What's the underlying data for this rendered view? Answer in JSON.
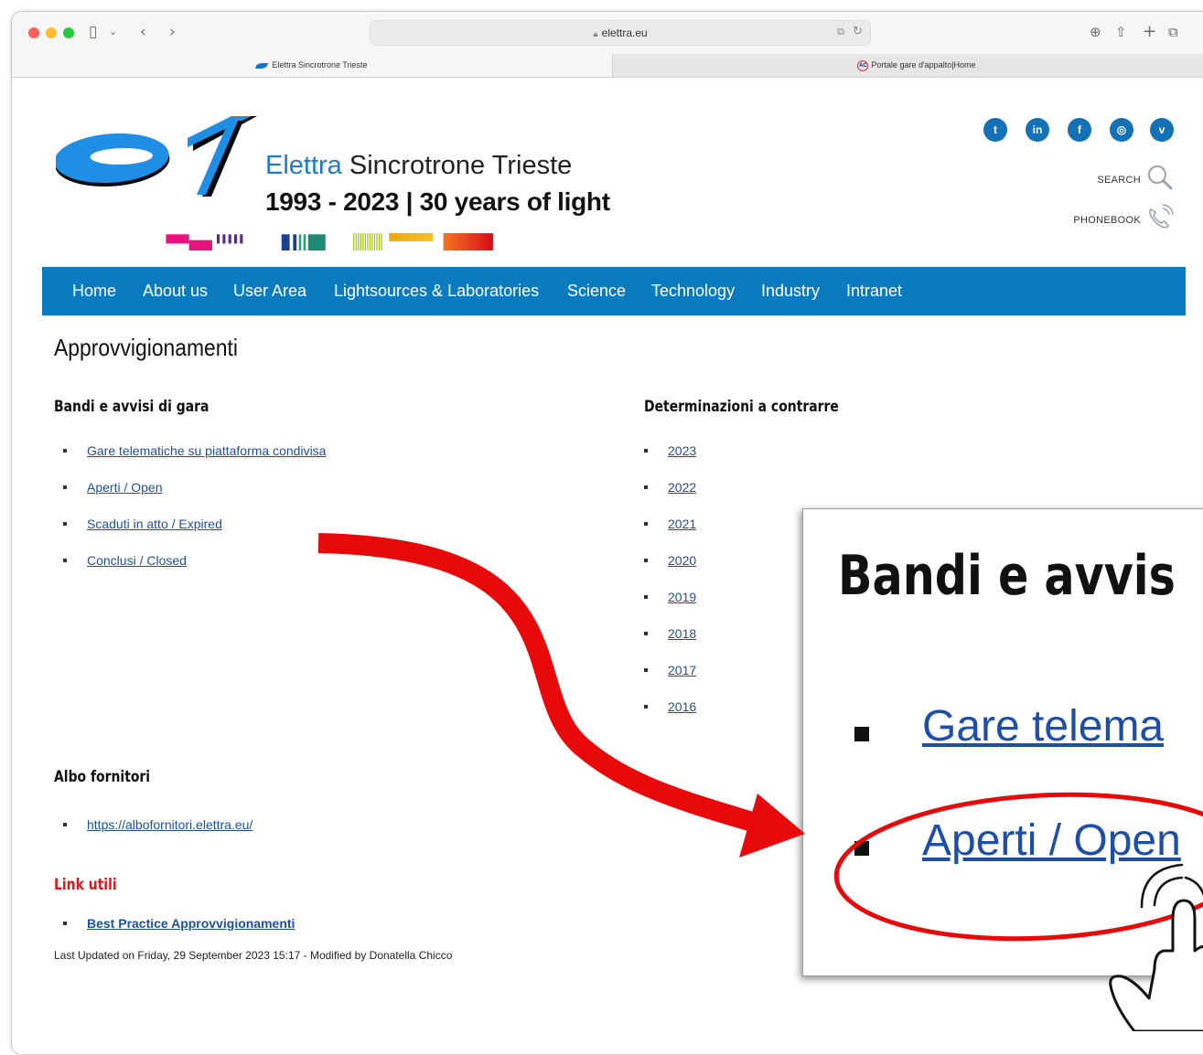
{
  "browser": {
    "url": "elettra.eu",
    "tabs": [
      {
        "label": "Elettra Sincrotrone Trieste"
      },
      {
        "label": "Portale gare d'appalto|Home"
      }
    ],
    "tab2_favicon_text": "AC"
  },
  "header": {
    "brand_name_colored": "Elettra",
    "brand_name_rest": " Sincrotrone Trieste",
    "brand_subtitle": "1993 - 2023 | 30 years of light",
    "social_icons": [
      "twitter-icon",
      "linkedin-icon",
      "facebook-icon",
      "instagram-icon",
      "vimeo-icon"
    ],
    "search_label": "SEARCH",
    "phonebook_label": "PHONEBOOK"
  },
  "nav": {
    "items": [
      "Home",
      "About us",
      "User Area",
      "Lightsources & Laboratories",
      "Science",
      "Technology",
      "Industry",
      "Intranet"
    ]
  },
  "main": {
    "title": "Approvvigionamenti",
    "bandi": {
      "heading": "Bandi e avvisi di gara",
      "links": [
        "Gare telematiche su piattaforma condivisa",
        "Aperti / Open",
        "Scaduti in atto / Expired",
        "Conclusi / Closed"
      ]
    },
    "determinazioni": {
      "heading": "Determinazioni a contrarre",
      "years": [
        "2023",
        "2022",
        "2021",
        "2020",
        "2019",
        "2018",
        "2017",
        "2016"
      ]
    },
    "albo": {
      "heading": "Albo fornitori",
      "link": "https://albofornitori.elettra.eu/"
    },
    "link_utili": {
      "heading": "Link utili",
      "link": "Best Practice Approvvigionamenti"
    },
    "footer_note": "Last Updated on Friday, 29 September 2023 15:17 - Modified by Donatella Chicco"
  },
  "zoom_overlay": {
    "heading": "Bandi e avvis",
    "item1": "Gare telema",
    "item2": "Aperti / Open"
  },
  "colors": {
    "nav_bg": "#0b7bc0",
    "link": "#1e4fa6",
    "accent_red": "#e0161b",
    "brand_blue": "#1b7bd0"
  }
}
